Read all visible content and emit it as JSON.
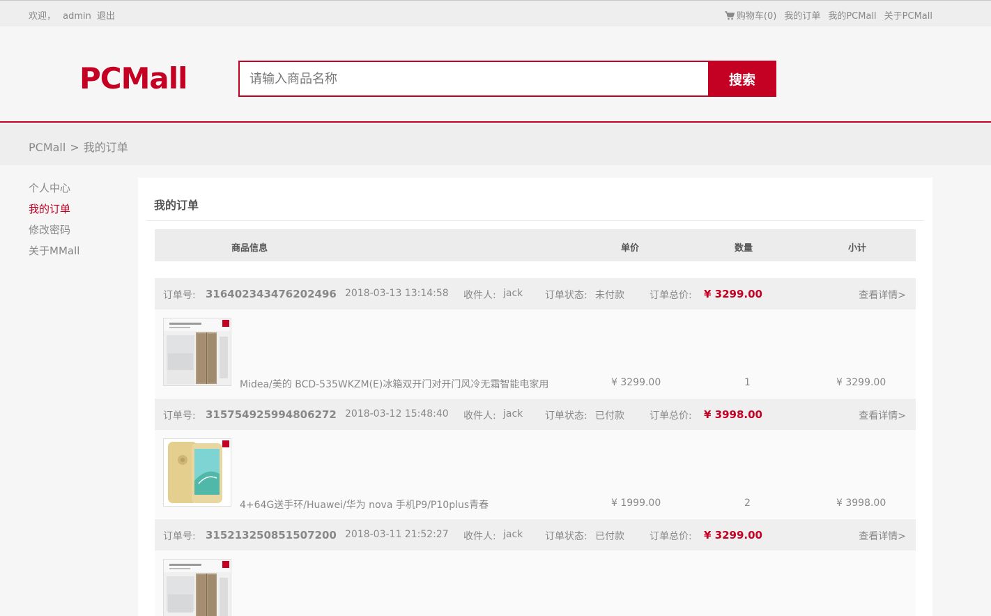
{
  "topbar": {
    "welcome": "欢迎，",
    "username": "admin",
    "logout": "退出",
    "cart": "购物车(0)",
    "my_orders": "我的订单",
    "my_pcmall": "我的PCMall",
    "about": "关于PCMall"
  },
  "header": {
    "logo": "PCMall",
    "search_placeholder": "请输入商品名称",
    "search_button": "搜索"
  },
  "breadcrumb": {
    "home": "PCMall",
    "separator": ">",
    "current": "我的订单"
  },
  "sidebar": {
    "items": [
      {
        "label": "个人中心"
      },
      {
        "label": "我的订单"
      },
      {
        "label": "修改密码"
      },
      {
        "label": "关于MMall"
      }
    ]
  },
  "main": {
    "title": "我的订单",
    "columns": {
      "product": "商品信息",
      "unit_price": "单价",
      "quantity": "数量",
      "subtotal": "小计"
    },
    "labels": {
      "order_no": "订单号:",
      "receiver": "收件人:",
      "status": "订单状态:",
      "total": "订单总价:",
      "detail": "查看详情>"
    },
    "orders": [
      {
        "order_no": "316402343476202496",
        "time": "2018-03-13 13:14:58",
        "receiver": "jack",
        "status": "未付款",
        "total": "¥ 3299.00",
        "item": {
          "name": "Midea/美的 BCD-535WKZM(E)冰箱双开门对开门风冷无霜智能电家用",
          "price": "¥ 3299.00",
          "qty": "1",
          "subtotal": "¥ 3299.00"
        }
      },
      {
        "order_no": "315754925994806272",
        "time": "2018-03-12 15:48:40",
        "receiver": "jack",
        "status": "已付款",
        "total": "¥ 3998.00",
        "item": {
          "name": "4+64G送手环/Huawei/华为 nova 手机P9/P10plus青春",
          "price": "¥ 1999.00",
          "qty": "2",
          "subtotal": "¥ 3998.00"
        }
      },
      {
        "order_no": "315213250851507200",
        "time": "2018-03-11 21:52:27",
        "receiver": "jack",
        "status": "已付款",
        "total": "¥ 3299.00"
      }
    ]
  },
  "colors": {
    "brand": "#c40023",
    "topbar_bg": "#eeeeee",
    "text_muted": "#888888"
  }
}
